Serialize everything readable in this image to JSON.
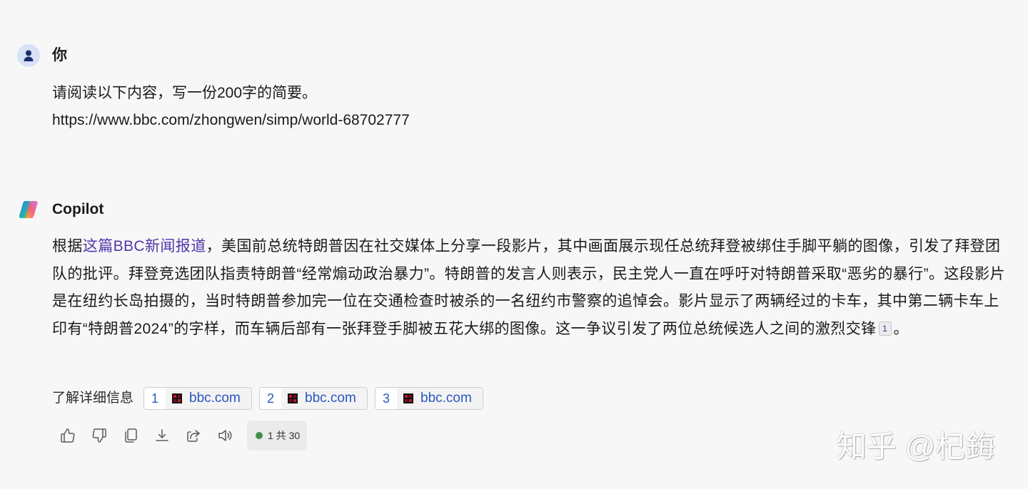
{
  "user": {
    "name": "你",
    "avatar_icon": "person-icon"
  },
  "user_message": {
    "lines": [
      "请阅读以下内容，写一份200字的简要。",
      "https://www.bbc.com/zhongwen/simp/world-68702777"
    ]
  },
  "copilot": {
    "name": "Copilot",
    "logo_icon": "copilot-logo-icon"
  },
  "response": {
    "prefix": "根据",
    "link_text": "这篇BBC新闻报道",
    "body": "，美国前总统特朗普因在社交媒体上分享一段影片，其中画面展示现任总统拜登被绑住手脚平躺的图像，引发了拜登团队的批评。拜登竞选团队指责特朗普“经常煽动政治暴力”。特朗普的发言人则表示，民主党人一直在呼吁对特朗普采取“恶劣的暴行”。这段影片是在纽约长岛拍摄的，当时特朗普参加完一位在交通检查时被杀的一名纽约市警察的追悼会。影片显示了两辆经过的卡车，其中第二辆卡车上印有“特朗普2024”的字样，而车辆后部有一张拜登手脚被五花大绑的图像。这一争议引发了两位总统候选人之间的激烈交锋",
    "citation": "1",
    "suffix": "。"
  },
  "learn_more": {
    "label": "了解详细信息",
    "sources": [
      {
        "index": "1",
        "site": "bbc.com",
        "favicon": "bbc-favicon-icon"
      },
      {
        "index": "2",
        "site": "bbc.com",
        "favicon": "bbc-favicon-icon"
      },
      {
        "index": "3",
        "site": "bbc.com",
        "favicon": "bbc-favicon-icon"
      }
    ]
  },
  "actions": {
    "buttons": [
      "thumbs-up-icon",
      "thumbs-down-icon",
      "copy-icon",
      "download-icon",
      "share-icon",
      "speaker-icon"
    ],
    "counter": "1 共 30"
  },
  "watermark": "知乎 @杞鋂",
  "colors": {
    "background": "#f7f7f7",
    "text": "#1b1b1b",
    "link": "#5136a8",
    "source_chip_text": "#2b57c0",
    "counter_dot": "#3f8f4f",
    "avatar_bg": "#d8e1f6",
    "avatar_icon": "#1c2f6c"
  }
}
